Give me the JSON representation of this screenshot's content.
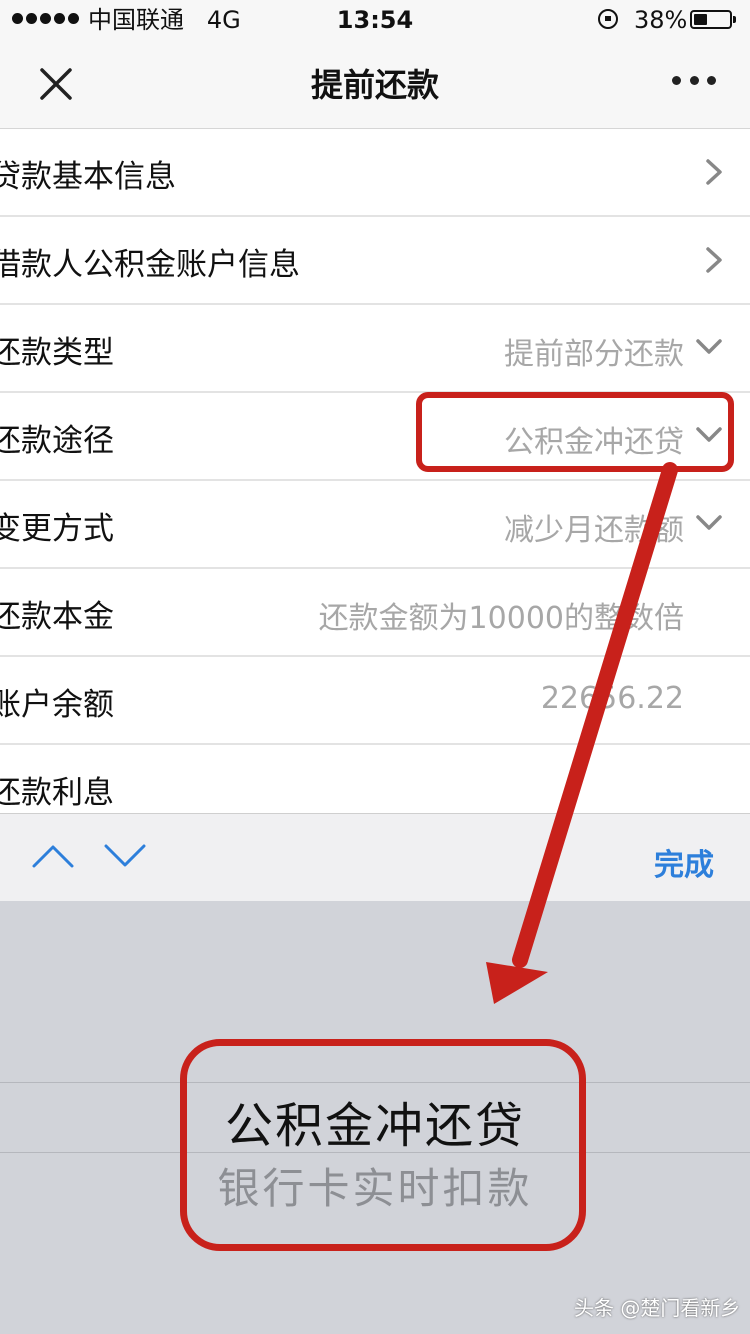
{
  "status_bar": {
    "carrier": "中国联通",
    "network": "4G",
    "time": "13:54",
    "battery_percent": "38%",
    "battery_level": 0.38
  },
  "nav": {
    "title": "提前还款",
    "close_icon": "close-icon",
    "more_icon": "more-icon"
  },
  "form": {
    "rows": [
      {
        "label": "贷款基本信息",
        "value": "",
        "accessory": "chevron-right-icon"
      },
      {
        "label": "借款人公积金账户信息",
        "value": "",
        "accessory": "chevron-right-icon"
      },
      {
        "label": "还款类型",
        "value": "提前部分还款",
        "accessory": "chevron-down-icon"
      },
      {
        "label": "还款途径",
        "value": "公积金冲还贷",
        "accessory": "chevron-down-icon"
      },
      {
        "label": "变更方式",
        "value": "减少月还款额",
        "accessory": "chevron-down-icon"
      },
      {
        "label": "还款本金",
        "value": "还款金额为10000的整数倍",
        "accessory": ""
      },
      {
        "label": "账户余额",
        "value": "22656.22",
        "accessory": ""
      },
      {
        "label": "还款利息",
        "value": "",
        "accessory": ""
      }
    ]
  },
  "toolbar": {
    "done_label": "完成",
    "up_icon": "chevron-up-icon",
    "down_icon": "chevron-down-icon"
  },
  "picker": {
    "selected": "公积金冲还贷",
    "options": [
      "公积金冲还贷",
      "银行卡实时扣款"
    ],
    "next_option": "银行卡实时扣款"
  },
  "annotation": {
    "color": "#c8211b"
  },
  "watermark": "头条 @楚门看新乡",
  "colors": {
    "link_blue": "#2d7fdb",
    "placeholder_gray": "#a7a7a7",
    "picker_bg": "#d1d3d9"
  }
}
